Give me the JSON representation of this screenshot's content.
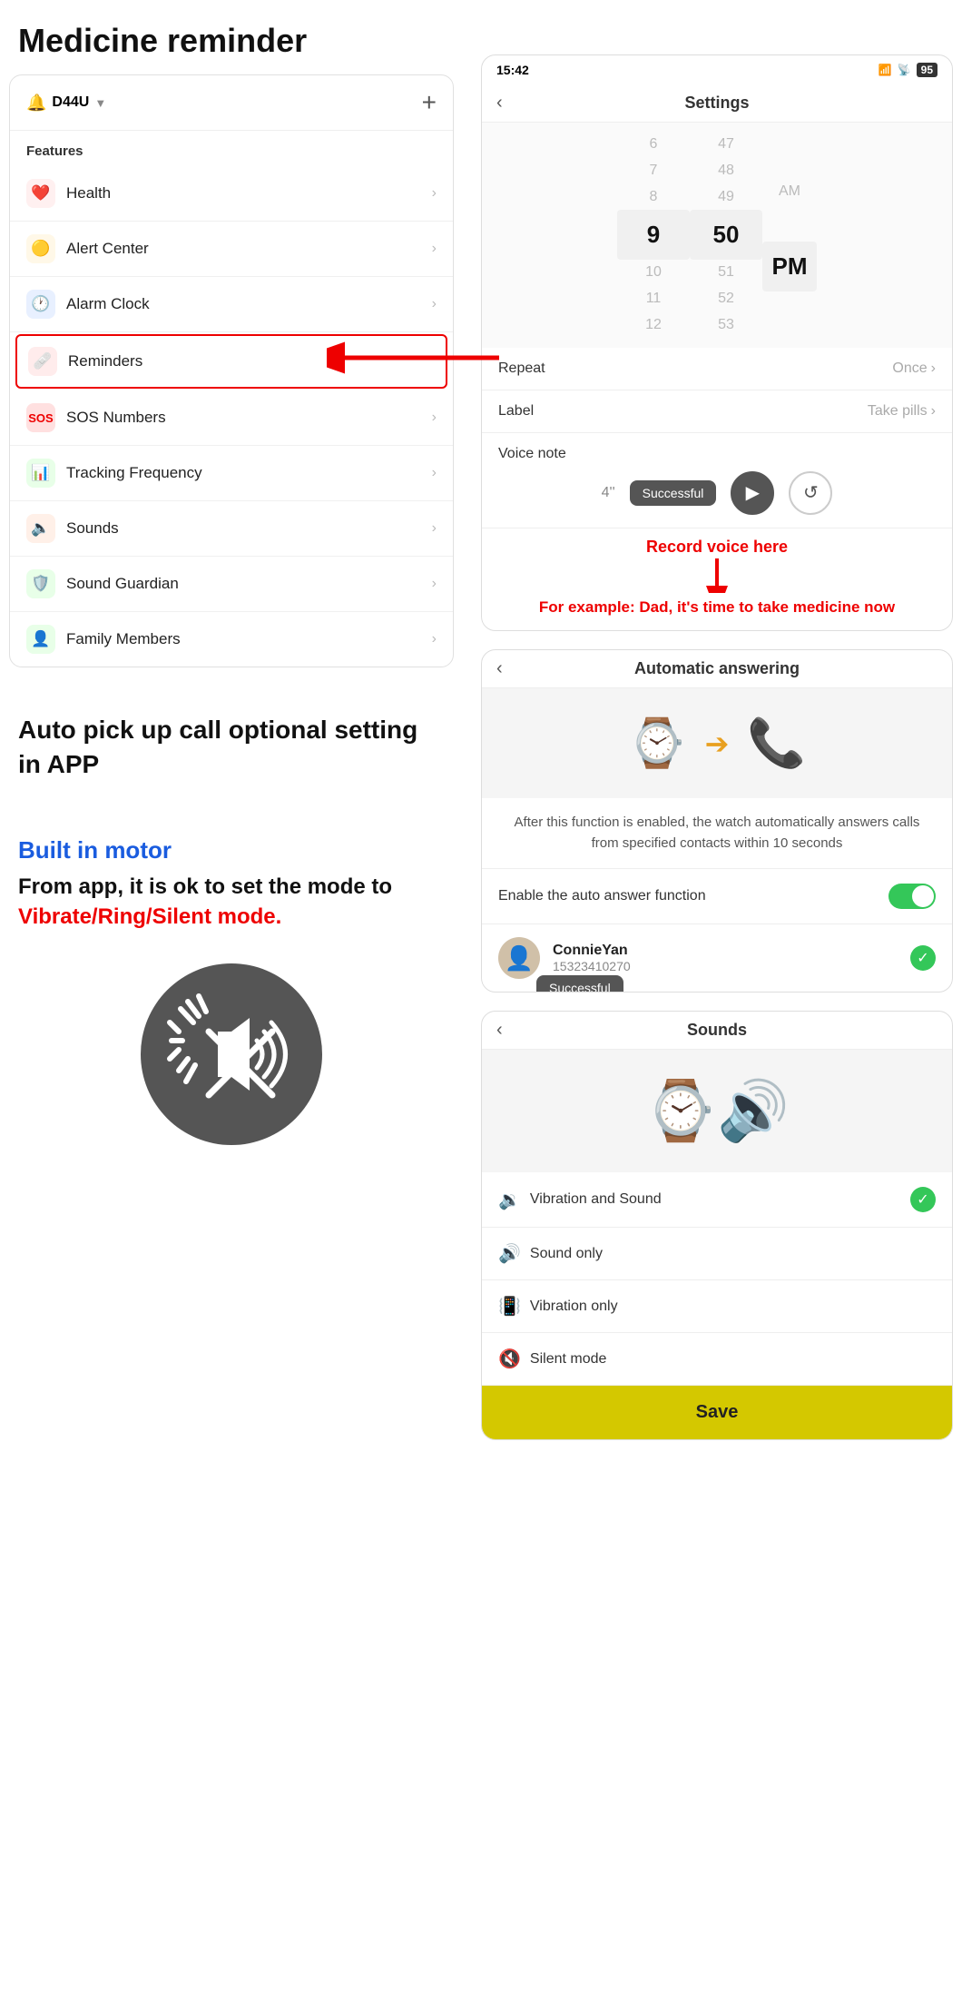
{
  "page": {
    "title": "Medicine reminder"
  },
  "left": {
    "device_name": "D44U",
    "device_icon": "🔔",
    "add_btn": "+",
    "features_label": "Features",
    "menu_items": [
      {
        "id": "health",
        "label": "Health",
        "icon": "❤️",
        "icon_class": "icon-health",
        "highlighted": false
      },
      {
        "id": "alert",
        "label": "Alert Center",
        "icon": "🟡",
        "icon_class": "icon-alert",
        "highlighted": false
      },
      {
        "id": "alarm",
        "label": "Alarm Clock",
        "icon": "🕐",
        "icon_class": "icon-alarm",
        "highlighted": false
      },
      {
        "id": "remind",
        "label": "Reminders",
        "icon": "🩹",
        "icon_class": "icon-remind",
        "highlighted": true
      },
      {
        "id": "sos",
        "label": "SOS Numbers",
        "icon": "🆘",
        "icon_class": "icon-sos",
        "highlighted": false
      },
      {
        "id": "tracking",
        "label": "Tracking Frequency",
        "icon": "📊",
        "icon_class": "icon-track",
        "highlighted": false
      },
      {
        "id": "sounds",
        "label": "Sounds",
        "icon": "🔈",
        "icon_class": "icon-sound",
        "highlighted": false
      },
      {
        "id": "guardian",
        "label": "Sound Guardian",
        "icon": "🛡️",
        "icon_class": "icon-guard",
        "highlighted": false
      },
      {
        "id": "family",
        "label": "Family Members",
        "icon": "👤",
        "icon_class": "icon-family",
        "highlighted": false
      }
    ],
    "auto_pickup_text": "Auto pick up call optional setting in APP",
    "built_in_motor": "Built in motor",
    "motor_desc1": "From app, it is ok to set the mode to",
    "motor_desc2": "Vibrate/Ring/Silent mode."
  },
  "right": {
    "settings_screen": {
      "status_time": "15:42",
      "battery": "95",
      "nav_title": "Settings",
      "time_picker": {
        "hour_items": [
          "6",
          "7",
          "8",
          "9",
          "10",
          "11",
          "12"
        ],
        "selected_hour": "9",
        "min_items": [
          "47",
          "48",
          "49",
          "50",
          "51",
          "52",
          "53"
        ],
        "selected_min": "50",
        "ampm_items": [
          "AM",
          "PM"
        ],
        "selected_ampm": "PM"
      },
      "repeat_label": "Repeat",
      "repeat_value": "Once",
      "label_label": "Label",
      "label_value": "Take pills",
      "voice_note_label": "Voice note",
      "voice_duration": "4''",
      "tooltip_successful": "Successful",
      "record_voice_label": "Record voice here",
      "example_label": "For example: Dad, it's time to take medicine now"
    },
    "auto_screen": {
      "nav_title": "Automatic answering",
      "desc": "After this function is enabled, the watch automatically answers calls from specified contacts within 10 seconds",
      "toggle_label": "Enable the auto answer function",
      "contact_name": "ConnieYan",
      "contact_phone": "15323410270",
      "tooltip_successful": "Successful"
    },
    "sounds_screen": {
      "nav_title": "Sounds",
      "options": [
        {
          "id": "vib_sound",
          "label": "Vibration and Sound",
          "icon": "🔉",
          "checked": true
        },
        {
          "id": "sound_only",
          "label": "Sound only",
          "icon": "🔊",
          "checked": false
        },
        {
          "id": "vib_only",
          "label": "Vibration only",
          "icon": "📳",
          "checked": false
        },
        {
          "id": "silent",
          "label": "Silent mode",
          "icon": "🔇",
          "checked": false
        }
      ],
      "save_btn": "Save"
    }
  }
}
